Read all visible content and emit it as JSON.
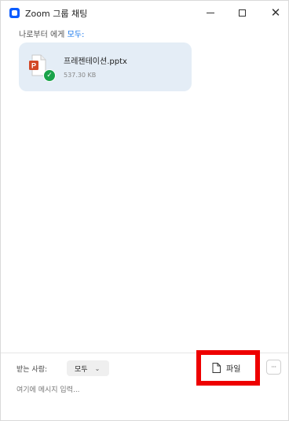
{
  "window": {
    "title": "Zoom 그룹 채팅",
    "close_glyph": "✕"
  },
  "chat": {
    "sender_prefix": "나로부터 에게 ",
    "sender_target": "모두:",
    "file": {
      "name": "프레젠테이션.pptx",
      "size": "537.30 KB",
      "status_glyph": "✓"
    }
  },
  "composer": {
    "recipient_label": "받는 사람:",
    "recipient_value": "모두",
    "recipient_chevron": "⌄",
    "file_button_label": "파일",
    "more_button_label": "···",
    "message_placeholder": "여기에 메시지 입력..."
  },
  "colors": {
    "accent": "#0e71eb",
    "highlight": "#ee0000",
    "file_card": "#e4edf6",
    "success": "#1aa34a"
  },
  "icons": {
    "app": "zoom-icon",
    "file": "powerpoint-icon",
    "status": "check-icon",
    "file_button": "document-icon"
  }
}
